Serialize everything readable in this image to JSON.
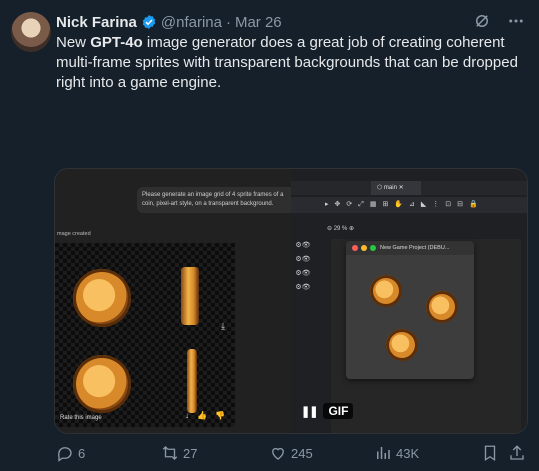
{
  "author": {
    "name": "Nick Farina",
    "handle": "@nfarina",
    "separator": "·",
    "date": "Mar 26"
  },
  "tweet": {
    "pre": "New ",
    "bold": "GPT-4o",
    "post": " image generator does a great job of creating coherent multi-frame sprites with transparent backgrounds that can be dropped right into a game engine."
  },
  "media": {
    "chatgpt": {
      "prompt": "Please generate an image grid of 4 sprite frames of a coin, pixel-art style, on a transparent background.",
      "image_created": "mage created",
      "rate": "Rate this image"
    },
    "editor": {
      "tab": "main",
      "zoom": "29 %",
      "window_title": "New Game Project (DEBU..."
    },
    "gif_label": "GIF"
  },
  "actions": {
    "replies": "6",
    "reposts": "27",
    "likes": "245",
    "views": "43K"
  },
  "colors": {
    "background": "#15202b",
    "text": "#e7e9ea",
    "muted": "#8b98a5",
    "verified": "#1d9bf0"
  },
  "icons": [
    "verified-badge-icon",
    "grok-icon",
    "more-icon",
    "reply-icon",
    "repost-icon",
    "like-icon",
    "views-icon",
    "bookmark-icon",
    "share-icon"
  ]
}
